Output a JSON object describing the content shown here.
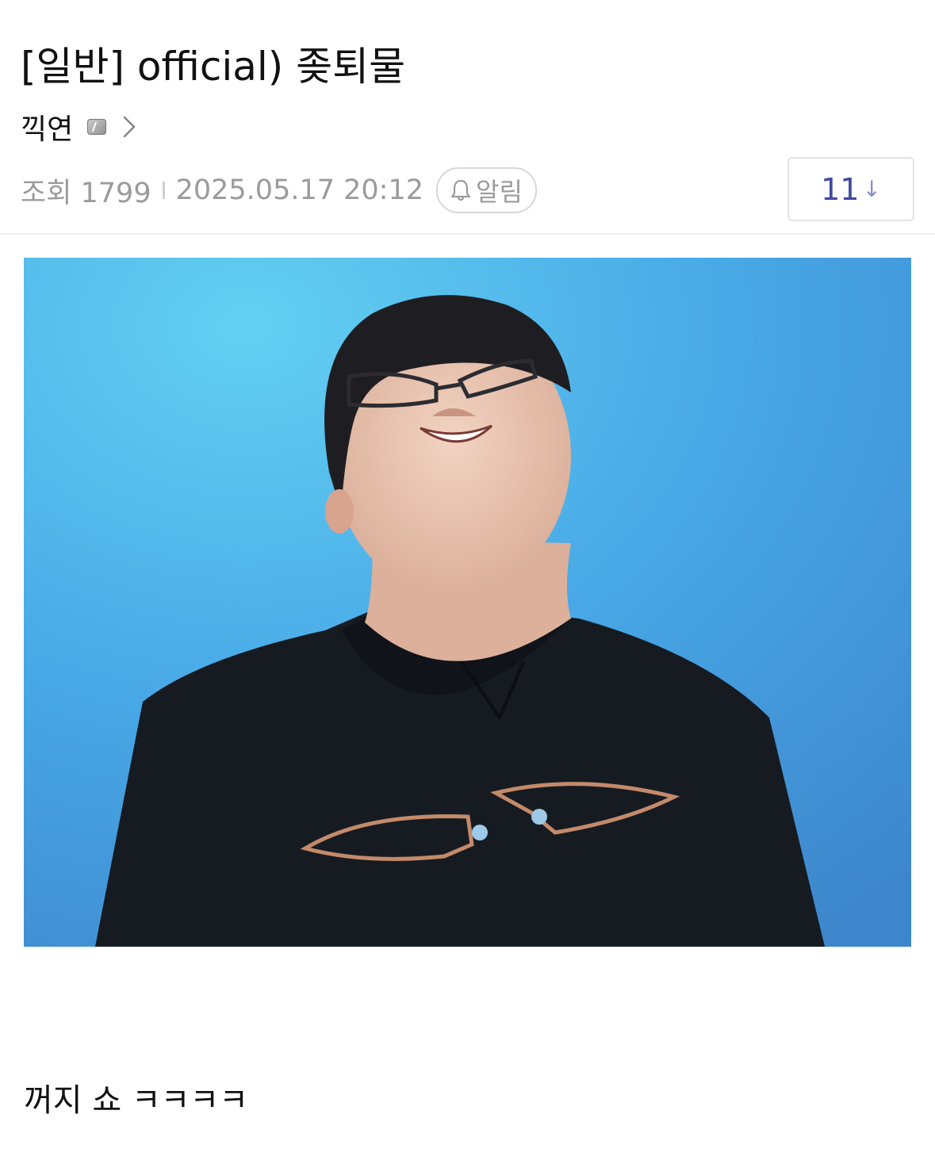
{
  "post": {
    "title": "[일반] official) 좆퇴물",
    "author": "끽연",
    "views": "조회 1799",
    "datetime": "2025.05.17 20:12",
    "alert_label": "알림",
    "comment_count": "11",
    "comment_arrow": "↓",
    "body": "꺼지 쇼 ㅋㅋㅋㅋ"
  },
  "icons": {
    "author_badge": "gallery-badge-icon",
    "author_chevron": "chevron-right-icon",
    "alert": "bell-icon",
    "comment_arrow": "arrow-down-icon"
  },
  "colors": {
    "comment_count": "#3f4aa0",
    "meta_gray": "#9b9b9b",
    "photo_bg": "#4aa6e4"
  }
}
